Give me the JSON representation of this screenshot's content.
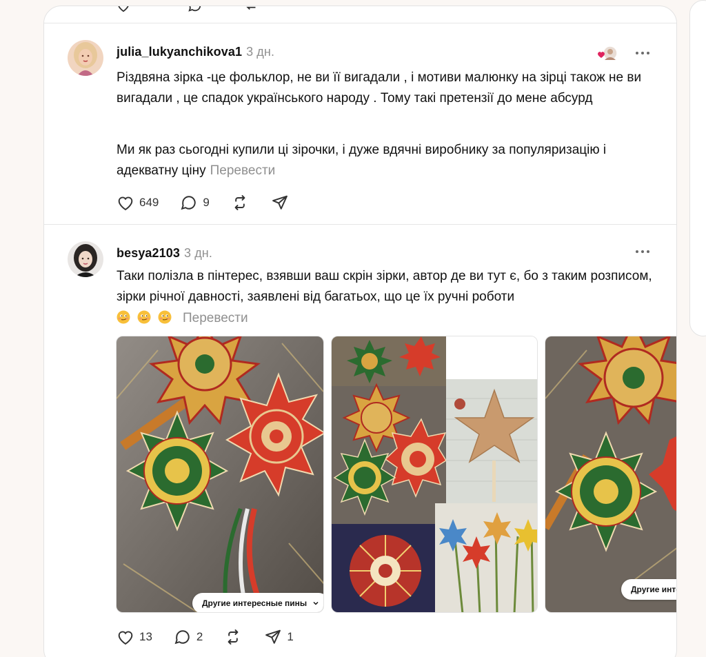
{
  "posts": [
    {
      "username": "julia_lukyanchikova1",
      "time": "3 дн.",
      "paragraph1": "Різдвяна зірка -це фольклор, не ви її вигадали , і мотиви малюнку на зірці також не ви вигадали , це спадок українського народу . Тому такі претензії до мене абсурд",
      "paragraph2": "Ми як раз сьогодні купили ці зірочки, і дуже вдячні виробнику за популяризацію і адекватну ціну",
      "translate": "Перевести",
      "likes": "649",
      "replies": "9",
      "reposts": "",
      "shares": ""
    },
    {
      "username": "besya2103",
      "time": "3 дн.",
      "text": "Таки полізла в пінтерес, взявши ваш скрін зірки, автор де ви тут є, бо з таким розписом, зірки річної давності, заявлені від багатьох, що це їх ручні роботи",
      "translate": "Перевести",
      "pin_button_1": "Другие интересные пины",
      "pin_button_2": "Другие интере",
      "likes": "13",
      "replies": "2",
      "reposts": "",
      "shares": "1"
    }
  ],
  "icons": {
    "like": "heart-icon",
    "reply": "speech-bubble-icon",
    "repost": "repost-icon",
    "share": "paper-plane-icon",
    "more": "more-dots-icon"
  },
  "colors": {
    "text": "#111111",
    "muted": "#8f8f8f",
    "divider": "#e6e6e6",
    "heart_red": "#e0245e",
    "star_red": "#d63c2a",
    "star_green": "#2b6b2f",
    "star_gold": "#d9a441"
  }
}
